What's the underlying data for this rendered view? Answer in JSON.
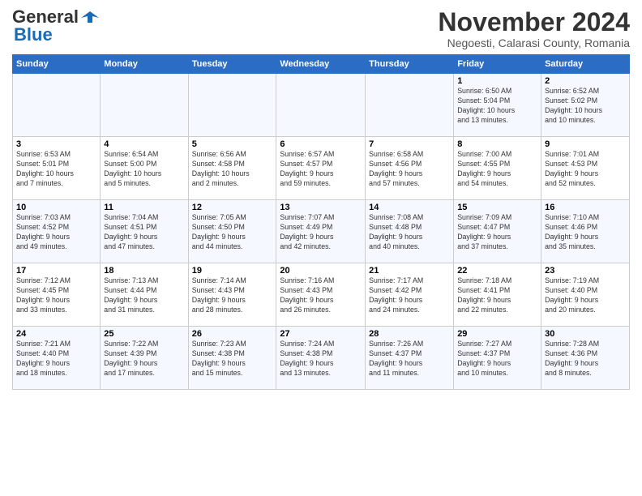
{
  "logo": {
    "general": "General",
    "blue": "Blue"
  },
  "header": {
    "month": "November 2024",
    "location": "Negoesti, Calarasi County, Romania"
  },
  "weekdays": [
    "Sunday",
    "Monday",
    "Tuesday",
    "Wednesday",
    "Thursday",
    "Friday",
    "Saturday"
  ],
  "weeks": [
    [
      {
        "day": "",
        "info": ""
      },
      {
        "day": "",
        "info": ""
      },
      {
        "day": "",
        "info": ""
      },
      {
        "day": "",
        "info": ""
      },
      {
        "day": "",
        "info": ""
      },
      {
        "day": "1",
        "info": "Sunrise: 6:50 AM\nSunset: 5:04 PM\nDaylight: 10 hours\nand 13 minutes."
      },
      {
        "day": "2",
        "info": "Sunrise: 6:52 AM\nSunset: 5:02 PM\nDaylight: 10 hours\nand 10 minutes."
      }
    ],
    [
      {
        "day": "3",
        "info": "Sunrise: 6:53 AM\nSunset: 5:01 PM\nDaylight: 10 hours\nand 7 minutes."
      },
      {
        "day": "4",
        "info": "Sunrise: 6:54 AM\nSunset: 5:00 PM\nDaylight: 10 hours\nand 5 minutes."
      },
      {
        "day": "5",
        "info": "Sunrise: 6:56 AM\nSunset: 4:58 PM\nDaylight: 10 hours\nand 2 minutes."
      },
      {
        "day": "6",
        "info": "Sunrise: 6:57 AM\nSunset: 4:57 PM\nDaylight: 9 hours\nand 59 minutes."
      },
      {
        "day": "7",
        "info": "Sunrise: 6:58 AM\nSunset: 4:56 PM\nDaylight: 9 hours\nand 57 minutes."
      },
      {
        "day": "8",
        "info": "Sunrise: 7:00 AM\nSunset: 4:55 PM\nDaylight: 9 hours\nand 54 minutes."
      },
      {
        "day": "9",
        "info": "Sunrise: 7:01 AM\nSunset: 4:53 PM\nDaylight: 9 hours\nand 52 minutes."
      }
    ],
    [
      {
        "day": "10",
        "info": "Sunrise: 7:03 AM\nSunset: 4:52 PM\nDaylight: 9 hours\nand 49 minutes."
      },
      {
        "day": "11",
        "info": "Sunrise: 7:04 AM\nSunset: 4:51 PM\nDaylight: 9 hours\nand 47 minutes."
      },
      {
        "day": "12",
        "info": "Sunrise: 7:05 AM\nSunset: 4:50 PM\nDaylight: 9 hours\nand 44 minutes."
      },
      {
        "day": "13",
        "info": "Sunrise: 7:07 AM\nSunset: 4:49 PM\nDaylight: 9 hours\nand 42 minutes."
      },
      {
        "day": "14",
        "info": "Sunrise: 7:08 AM\nSunset: 4:48 PM\nDaylight: 9 hours\nand 40 minutes."
      },
      {
        "day": "15",
        "info": "Sunrise: 7:09 AM\nSunset: 4:47 PM\nDaylight: 9 hours\nand 37 minutes."
      },
      {
        "day": "16",
        "info": "Sunrise: 7:10 AM\nSunset: 4:46 PM\nDaylight: 9 hours\nand 35 minutes."
      }
    ],
    [
      {
        "day": "17",
        "info": "Sunrise: 7:12 AM\nSunset: 4:45 PM\nDaylight: 9 hours\nand 33 minutes."
      },
      {
        "day": "18",
        "info": "Sunrise: 7:13 AM\nSunset: 4:44 PM\nDaylight: 9 hours\nand 31 minutes."
      },
      {
        "day": "19",
        "info": "Sunrise: 7:14 AM\nSunset: 4:43 PM\nDaylight: 9 hours\nand 28 minutes."
      },
      {
        "day": "20",
        "info": "Sunrise: 7:16 AM\nSunset: 4:43 PM\nDaylight: 9 hours\nand 26 minutes."
      },
      {
        "day": "21",
        "info": "Sunrise: 7:17 AM\nSunset: 4:42 PM\nDaylight: 9 hours\nand 24 minutes."
      },
      {
        "day": "22",
        "info": "Sunrise: 7:18 AM\nSunset: 4:41 PM\nDaylight: 9 hours\nand 22 minutes."
      },
      {
        "day": "23",
        "info": "Sunrise: 7:19 AM\nSunset: 4:40 PM\nDaylight: 9 hours\nand 20 minutes."
      }
    ],
    [
      {
        "day": "24",
        "info": "Sunrise: 7:21 AM\nSunset: 4:40 PM\nDaylight: 9 hours\nand 18 minutes."
      },
      {
        "day": "25",
        "info": "Sunrise: 7:22 AM\nSunset: 4:39 PM\nDaylight: 9 hours\nand 17 minutes."
      },
      {
        "day": "26",
        "info": "Sunrise: 7:23 AM\nSunset: 4:38 PM\nDaylight: 9 hours\nand 15 minutes."
      },
      {
        "day": "27",
        "info": "Sunrise: 7:24 AM\nSunset: 4:38 PM\nDaylight: 9 hours\nand 13 minutes."
      },
      {
        "day": "28",
        "info": "Sunrise: 7:26 AM\nSunset: 4:37 PM\nDaylight: 9 hours\nand 11 minutes."
      },
      {
        "day": "29",
        "info": "Sunrise: 7:27 AM\nSunset: 4:37 PM\nDaylight: 9 hours\nand 10 minutes."
      },
      {
        "day": "30",
        "info": "Sunrise: 7:28 AM\nSunset: 4:36 PM\nDaylight: 9 hours\nand 8 minutes."
      }
    ]
  ]
}
